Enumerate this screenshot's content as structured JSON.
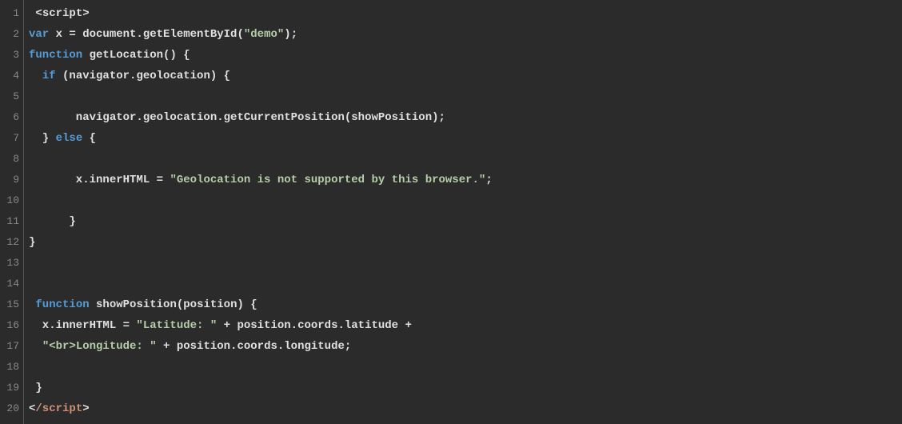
{
  "editor": {
    "lineNumbers": [
      "1",
      "2",
      "3",
      "4",
      "5",
      "6",
      "7",
      "8",
      "9",
      "10",
      "11",
      "12",
      "13",
      "14",
      "15",
      "16",
      "17",
      "18",
      "19",
      "20"
    ],
    "lines": [
      [
        {
          "t": " <",
          "c": "plain"
        },
        {
          "t": "script",
          "c": "tag-open"
        },
        {
          "t": ">",
          "c": "plain"
        }
      ],
      [
        {
          "t": "var",
          "c": "kw"
        },
        {
          "t": " x = document.",
          "c": "plain"
        },
        {
          "t": "getElementById",
          "c": "fn"
        },
        {
          "t": "(",
          "c": "plain"
        },
        {
          "t": "\"demo\"",
          "c": "str"
        },
        {
          "t": ");",
          "c": "plain"
        }
      ],
      [
        {
          "t": "function",
          "c": "kw"
        },
        {
          "t": " ",
          "c": "plain"
        },
        {
          "t": "getLocation",
          "c": "fn"
        },
        {
          "t": "() {",
          "c": "plain"
        }
      ],
      [
        {
          "t": "  ",
          "c": "plain"
        },
        {
          "t": "if",
          "c": "kw"
        },
        {
          "t": " (navigator.geolocation) {",
          "c": "plain"
        }
      ],
      [],
      [
        {
          "t": "       navigator.geolocation.",
          "c": "plain"
        },
        {
          "t": "getCurrentPosition",
          "c": "fn"
        },
        {
          "t": "(showPosition);",
          "c": "plain"
        }
      ],
      [
        {
          "t": "  } ",
          "c": "plain"
        },
        {
          "t": "else",
          "c": "kw"
        },
        {
          "t": " {",
          "c": "plain"
        }
      ],
      [],
      [
        {
          "t": "       x.innerHTML = ",
          "c": "plain"
        },
        {
          "t": "\"Geolocation is not supported by this browser.\"",
          "c": "str"
        },
        {
          "t": ";",
          "c": "plain"
        }
      ],
      [],
      [
        {
          "t": "      }",
          "c": "plain"
        }
      ],
      [
        {
          "t": "}",
          "c": "plain"
        }
      ],
      [],
      [],
      [
        {
          "t": " ",
          "c": "plain"
        },
        {
          "t": "function",
          "c": "kw"
        },
        {
          "t": " ",
          "c": "plain"
        },
        {
          "t": "showPosition",
          "c": "fn"
        },
        {
          "t": "(position) {",
          "c": "plain"
        }
      ],
      [
        {
          "t": "  x.innerHTML = ",
          "c": "plain"
        },
        {
          "t": "\"Latitude: \"",
          "c": "str"
        },
        {
          "t": " + position.coords.latitude +",
          "c": "plain"
        }
      ],
      [
        {
          "t": "  ",
          "c": "plain"
        },
        {
          "t": "\"<br>Longitude: \"",
          "c": "str"
        },
        {
          "t": " + position.coords.longitude;",
          "c": "plain"
        }
      ],
      [],
      [
        {
          "t": " }",
          "c": "plain"
        }
      ],
      [
        {
          "t": "<",
          "c": "plain"
        },
        {
          "t": "/script",
          "c": "tag-close"
        },
        {
          "t": ">",
          "c": "plain"
        }
      ]
    ]
  }
}
